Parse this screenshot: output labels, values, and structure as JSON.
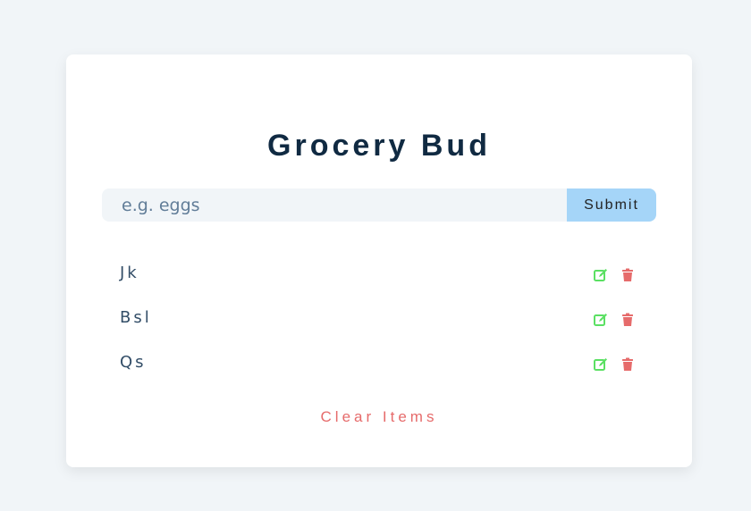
{
  "app": {
    "title": "Grocery Bud"
  },
  "form": {
    "placeholder": "e.g. eggs",
    "submit_label": "Submit"
  },
  "items": [
    {
      "title": "Jk",
      "edit_icon": "edit-icon",
      "delete_icon": "trash-icon"
    },
    {
      "title": "Bsl",
      "edit_icon": "edit-icon",
      "delete_icon": "trash-icon"
    },
    {
      "title": "Qs",
      "edit_icon": "edit-icon",
      "delete_icon": "trash-icon"
    }
  ],
  "clear_label": "Clear Items",
  "colors": {
    "background": "#f1f5f8",
    "title": "#102a42",
    "submit_bg": "#a5d5f8",
    "edit": "#5be063",
    "delete": "#e66b6b",
    "clear": "#e66b6b"
  }
}
